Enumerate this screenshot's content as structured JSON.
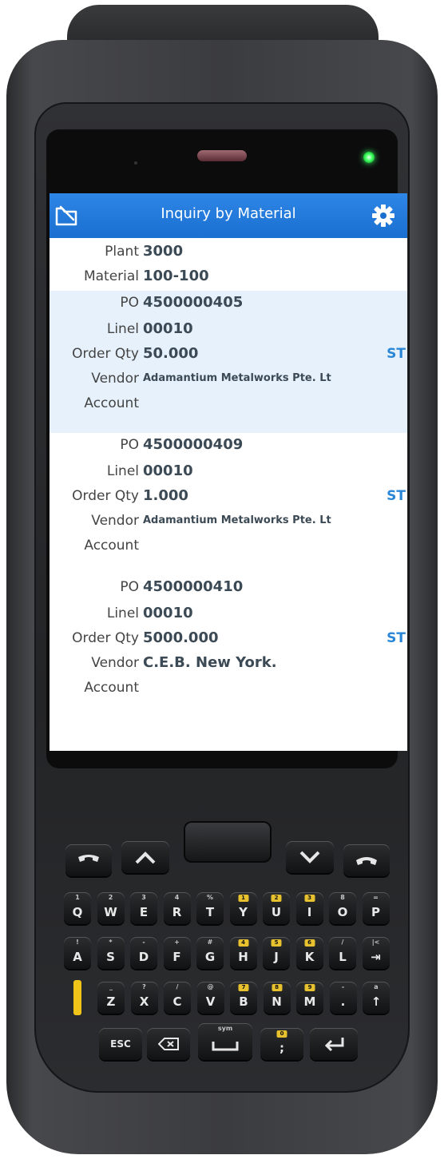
{
  "app": {
    "title": "Inquiry by Material",
    "back_icon": "back-folder-icon",
    "settings_icon": "gear-icon"
  },
  "header": {
    "plant_label": "Plant",
    "plant_value": "3000",
    "material_label": "Material",
    "material_value": "100-100"
  },
  "labels": {
    "po": "PO",
    "line": "Linel",
    "order_qty": "Order Qty",
    "vendor": "Vendor",
    "account": "Account"
  },
  "orders": [
    {
      "po": "4500000405",
      "line": "00010",
      "qty": "50.000",
      "uom": "ST",
      "vendor": "Adamantium Metalworks Pte. Lt",
      "account": ""
    },
    {
      "po": "4500000409",
      "line": "00010",
      "qty": "1.000",
      "uom": "ST",
      "vendor": "Adamantium Metalworks Pte. Lt",
      "account": ""
    },
    {
      "po": "4500000410",
      "line": "00010",
      "qty": "5000.000",
      "uom": "ST",
      "vendor": "C.E.B. New York.",
      "account": ""
    }
  ],
  "keypad": {
    "row1": [
      {
        "k": "Q",
        "s": "1"
      },
      {
        "k": "W",
        "s": "2"
      },
      {
        "k": "E",
        "s": "3"
      },
      {
        "k": "R",
        "s": "4"
      },
      {
        "k": "T",
        "s": "%"
      },
      {
        "k": "Y",
        "s": "1",
        "y": true
      },
      {
        "k": "U",
        "s": "2",
        "y": true
      },
      {
        "k": "I",
        "s": "3",
        "y": true
      },
      {
        "k": "O",
        "s": "8"
      },
      {
        "k": "P",
        "s": "="
      }
    ],
    "row2": [
      {
        "k": "A",
        "s": "!"
      },
      {
        "k": "S",
        "s": "*"
      },
      {
        "k": "D",
        "s": "-"
      },
      {
        "k": "F",
        "s": "+"
      },
      {
        "k": "G",
        "s": "#"
      },
      {
        "k": "H",
        "s": "4",
        "y": true
      },
      {
        "k": "J",
        "s": "5",
        "y": true
      },
      {
        "k": "K",
        "s": "6",
        "y": true
      },
      {
        "k": "L",
        "s": "/"
      },
      {
        "k": "⇥",
        "s": "|<"
      }
    ],
    "row3": [
      {
        "k": "Z",
        "s": "_"
      },
      {
        "k": "X",
        "s": "?"
      },
      {
        "k": "C",
        "s": "/"
      },
      {
        "k": "V",
        "s": "@"
      },
      {
        "k": "B",
        "s": "7",
        "y": true
      },
      {
        "k": "N",
        "s": "8",
        "y": true
      },
      {
        "k": "M",
        "s": "9",
        "y": true
      },
      {
        "k": ".",
        "s": "-"
      },
      {
        "k": "↑",
        "s": "a"
      }
    ],
    "esc": "ESC",
    "sym": "sym"
  }
}
